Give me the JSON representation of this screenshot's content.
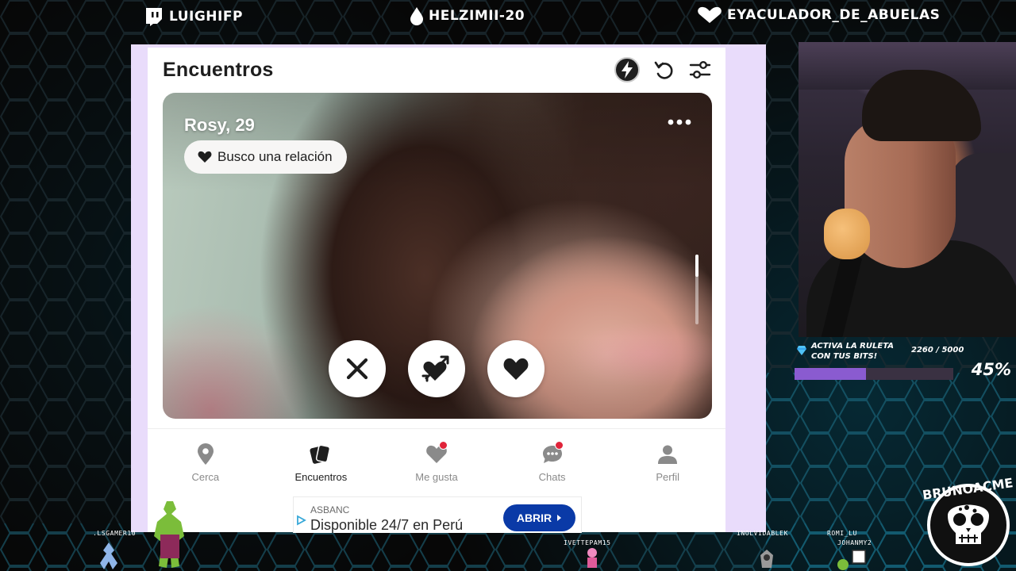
{
  "overlay": {
    "top_names": [
      {
        "icon": "twitch-icon",
        "name": "LUIGHIFP"
      },
      {
        "icon": "drop-icon",
        "name": "HELZIMII-20"
      },
      {
        "icon": "heart-icon",
        "name": "EYACULADOR_DE_ABUELAS"
      }
    ],
    "bits_goal": {
      "label": "ACTIVA LA RULETA CON TUS BITS!",
      "count": "2260 / 5000",
      "percent_text": "45%",
      "fraction": 0.45
    },
    "brand_logo_text": "BRUNOACME",
    "handle_tag": "BRUNOACME",
    "chat_viewers": [
      ".LSGAMER10",
      "IVETTEPAM15",
      "INOLVIDABLEK",
      "ROMI_LU",
      "JOHANMY2"
    ]
  },
  "app": {
    "title": "Encuentros",
    "header_icons": [
      "bolt-icon",
      "undo-icon",
      "filter-icon"
    ],
    "profile": {
      "name_age": "Rosy, 29",
      "intent_label": "Busco una relación"
    },
    "actions": [
      "dislike-x-icon",
      "crush-heart-arrow-icon",
      "like-heart-icon"
    ],
    "nav": [
      {
        "label": "Cerca",
        "icon": "location-pin-icon",
        "active": false,
        "badge": false
      },
      {
        "label": "Encuentros",
        "icon": "cards-icon",
        "active": true,
        "badge": false
      },
      {
        "label": "Me gusta",
        "icon": "heart-outline-icon",
        "active": false,
        "badge": true
      },
      {
        "label": "Chats",
        "icon": "chat-bubble-icon",
        "active": false,
        "badge": true
      },
      {
        "label": "Perfil",
        "icon": "person-icon",
        "active": false,
        "badge": false
      }
    ],
    "ad": {
      "brand": "ASBANC",
      "text": "Disponible 24/7 en Perú",
      "button": "ABRIR"
    }
  },
  "colors": {
    "frame_lavender": "#e9dcfb",
    "ad_button": "#0a3aa7",
    "badge_red": "#e0243a",
    "bits_fill": "#8a5bd0"
  }
}
